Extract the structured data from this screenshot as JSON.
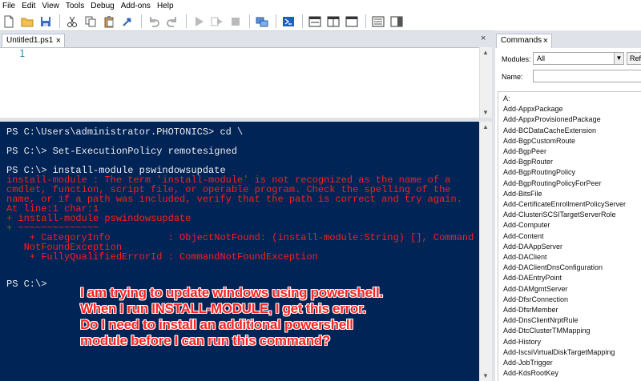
{
  "menu": [
    "File",
    "Edit",
    "View",
    "Tools",
    "Debug",
    "Add-ons",
    "Help"
  ],
  "editor": {
    "tab_label": "Untitled1.ps1",
    "tab_close": "×",
    "line_number": "1"
  },
  "console": {
    "lines": [
      {
        "text": "PS C:\\Users\\administrator.PHOTONICS> cd \\",
        "kind": "normal"
      },
      {
        "text": "PS C:\\> Set-ExecutionPolicy remotesigned",
        "kind": "normal"
      },
      {
        "text": "PS C:\\> install-module pswindowsupdate",
        "kind": "normal"
      },
      {
        "text": "install-module : The term 'install-module' is not recognized as the name of a",
        "kind": "error"
      },
      {
        "text": "cmdlet, function, script file, or operable program. Check the spelling of the",
        "kind": "error"
      },
      {
        "text": "name, or if a path was included, verify that the path is correct and try again.",
        "kind": "error"
      },
      {
        "text": "At line:1 char:1",
        "kind": "error"
      },
      {
        "text": "+ install-module pswindowsupdate",
        "kind": "error"
      },
      {
        "text": "+ ~~~~~~~~~~~~~~",
        "kind": "error"
      },
      {
        "text": "    + CategoryInfo          : ObjectNotFound: (install-module:String) [], Command",
        "kind": "error"
      },
      {
        "text": "   NotFoundException",
        "kind": "error"
      },
      {
        "text": "    + FullyQualifiedErrorId : CommandNotFoundException",
        "kind": "error"
      },
      {
        "text": "PS C:\\>",
        "kind": "normal"
      }
    ]
  },
  "annotation": [
    "I am trying to update windows using powershell.",
    "When I run INSTALL-MODULE, I get this error.",
    "Do I need to install an additional powershell",
    "module before I can run this command?"
  ],
  "commands_panel": {
    "tab_label": "Commands",
    "tab_close": "×",
    "modules_label": "Modules:",
    "modules_value": "All",
    "refresh_label": "Refresh",
    "name_label": "Name:",
    "name_value": "",
    "items": [
      "A:",
      "Add-AppxPackage",
      "Add-AppxProvisionedPackage",
      "Add-BCDataCacheExtension",
      "Add-BgpCustomRoute",
      "Add-BgpPeer",
      "Add-BgpRouter",
      "Add-BgpRoutingPolicy",
      "Add-BgpRoutingPolicyForPeer",
      "Add-BitsFile",
      "Add-CertificateEnrollmentPolicyServer",
      "Add-ClusteriSCSITargetServerRole",
      "Add-Computer",
      "Add-Content",
      "Add-DAAppServer",
      "Add-DAClient",
      "Add-DAClientDnsConfiguration",
      "Add-DAEntryPoint",
      "Add-DAMgmtServer",
      "Add-DfsrConnection",
      "Add-DfsrMember",
      "Add-DnsClientNrptRule",
      "Add-DtcClusterTMMapping",
      "Add-History",
      "Add-IscsiVirtualDiskTargetMapping",
      "Add-JobTrigger",
      "Add-KdsRootKey"
    ]
  },
  "colors": {
    "console_bg": "#012456",
    "console_text": "#eeedf0",
    "error_text": "#ff1e1e",
    "annotation": "#ff2222",
    "line_number": "#2b91af"
  },
  "toolbar_icons": [
    "new-file-icon",
    "open-folder-icon",
    "save-icon",
    "cut-icon",
    "copy-icon",
    "paste-icon",
    "clear-icon",
    "undo-icon",
    "redo-icon",
    "run-icon",
    "run-selection-icon",
    "stop-icon",
    "remote-icon",
    "powershell-icon",
    "layout-top-icon",
    "layout-right-icon",
    "layout-max-icon",
    "show-script-icon",
    "show-commands-icon"
  ]
}
